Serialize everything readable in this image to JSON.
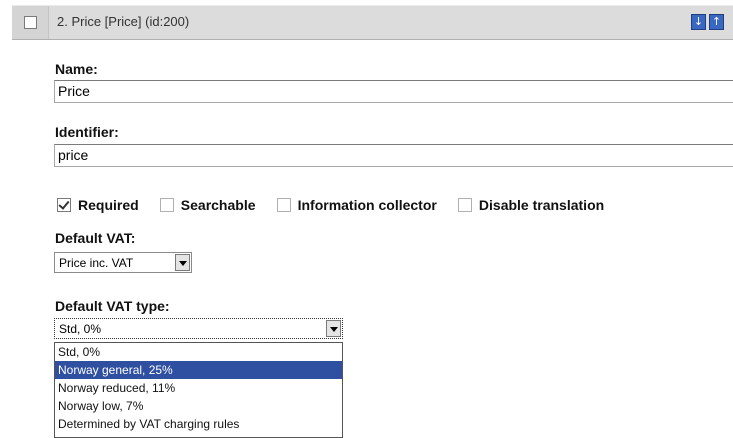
{
  "header": {
    "title": "2. Price [Price] (id:200)",
    "move_down_icon": "arrow-down-icon",
    "move_up_icon": "arrow-up-icon"
  },
  "name": {
    "label": "Name:",
    "value": "Price"
  },
  "identifier": {
    "label": "Identifier:",
    "value": "price"
  },
  "checkboxes": [
    {
      "label": "Required",
      "checked": true
    },
    {
      "label": "Searchable",
      "checked": false
    },
    {
      "label": "Information collector",
      "checked": false
    },
    {
      "label": "Disable translation",
      "checked": false
    }
  ],
  "default_vat": {
    "label": "Default VAT:",
    "selected": "Price inc. VAT"
  },
  "default_vat_type": {
    "label": "Default VAT type:",
    "selected": "Std, 0%",
    "highlighted_option": "Norway general, 25%",
    "options": [
      "Std, 0%",
      "Norway general, 25%",
      "Norway reduced, 11%",
      "Norway low, 7%",
      "Determined by VAT charging rules"
    ]
  },
  "colors": {
    "highlight": "#2f4fa0",
    "header_bg": "#dcdcdc",
    "button": "#3a67c0"
  }
}
